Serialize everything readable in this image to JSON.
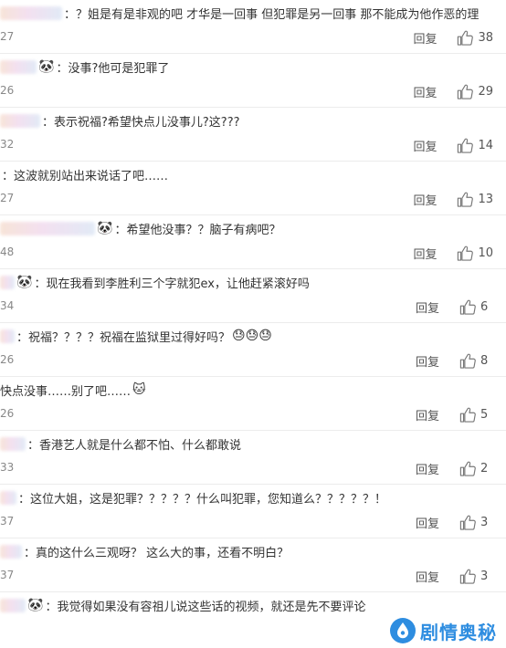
{
  "colors": {
    "like_icon": "#777777",
    "watermark": "#2e8de0"
  },
  "comments": [
    {
      "text": "：？姐是有是非观的吧 才华是一回事 但犯罪是另一回事 那不能成为他作恶的理",
      "time": "27",
      "reply_label": "回复",
      "likes": "38",
      "emoji": ""
    },
    {
      "text": "：没事?他可是犯罪了",
      "time": "26",
      "reply_label": "回复",
      "likes": "29",
      "emoji": "panda-icon"
    },
    {
      "text": "：表示祝福?希望快点儿没事儿?这???",
      "time": "32",
      "reply_label": "回复",
      "likes": "14",
      "emoji": ""
    },
    {
      "text": "：这波就别站出来说话了吧……",
      "time": "27",
      "reply_label": "回复",
      "likes": "13",
      "emoji": ""
    },
    {
      "text": "：希望他没事？？脑子有病吧？",
      "time": "48",
      "reply_label": "回复",
      "likes": "10",
      "emoji": "panda-icon"
    },
    {
      "text": "：现在我看到李胜利三个字就犯ex，让他赶紧滚好吗",
      "time": "34",
      "reply_label": "回复",
      "likes": "6",
      "emoji": "panda-icon"
    },
    {
      "text": "：祝福？？？？祝福在监狱里过得好吗？",
      "time": "26",
      "reply_label": "回复",
      "likes": "8",
      "emoji": "",
      "trailing_emojis": "😓😓😓"
    },
    {
      "text": "快点没事……别了吧……",
      "time": "26",
      "reply_label": "回复",
      "likes": "5",
      "emoji": "",
      "trailing_emojis": "🐱"
    },
    {
      "text": "：香港艺人就是什么都不怕、什么都敢说",
      "time": "33",
      "reply_label": "回复",
      "likes": "2",
      "emoji": ""
    },
    {
      "text": "：这位大姐，这是犯罪？？？？？什么叫犯罪，您知道么？？？？？！",
      "time": "37",
      "reply_label": "回复",
      "likes": "3",
      "emoji": ""
    },
    {
      "text": "：真的这什么三观呀？ 这么大的事，还看不明白？",
      "time": "37",
      "reply_label": "回复",
      "likes": "3",
      "emoji": ""
    },
    {
      "text": "：我觉得如果没有容祖儿说这些话的视频，就还是先不要评论",
      "time": "",
      "reply_label": "",
      "likes": "",
      "emoji": "panda-icon"
    }
  ],
  "watermark": {
    "text": "剧情奥秘",
    "icon": "drop-icon"
  }
}
